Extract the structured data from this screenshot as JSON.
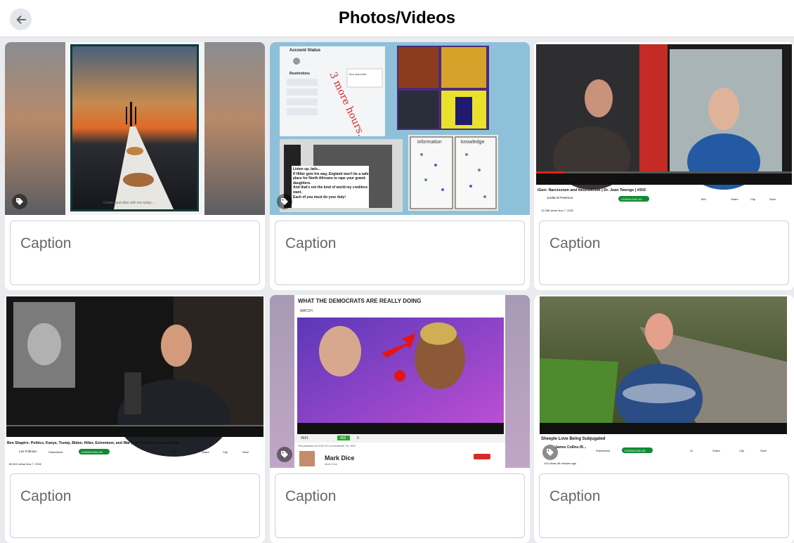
{
  "header": {
    "title": "Photos/Videos",
    "back_icon": "arrow-left-icon"
  },
  "caption_placeholder": "Caption",
  "cards": [
    {
      "texts": [
        "Comes and dine with me today…"
      ]
    },
    {
      "texts": [
        "Account Status",
        "Restrictions",
        "3 more hours.",
        "Your accounts",
        "information",
        "knowledge",
        "Listen up, lads...",
        "If Hitler gets his way, England won't be a safe place for North Africans to rape your grand-daughters.",
        "And that's not the kind of world my creditors want.",
        "Each of you must do your duty!"
      ]
    },
    {
      "texts": [
        "iGen: Narcissism and Neuroticism | Dr. Jean Twenge | #303",
        "Jordan B Peterson",
        "DOWNLOAD AS",
        "893",
        "Share",
        "Clip",
        "Save",
        "12,258 views  Nov 7, 2022"
      ]
    },
    {
      "texts": [
        "Ben Shapiro: Politics, Kanye, Trump, Biden, Hitler, Extremism, and War | Lex Fridman Podcast #336",
        "Lex Fridman",
        "Subscribed",
        "DOWNLOAD AS",
        "4.9K",
        "Share",
        "Clip",
        "Save",
        "80,513 views  Nov 7, 2022"
      ]
    },
    {
      "texts": [
        "WHAT THE DEMOCRATS ARE REALLY DOING",
        "WATCH",
        "4691",
        "403",
        "0",
        "First published at 13:30 UTC on November 7th, 2022",
        "Mark Dice",
        "Mark Dice"
      ]
    },
    {
      "texts": [
        "Sheeple Love Being Subjugated",
        "James Collins IR...",
        "Subscribed",
        "DOWNLOAD AS",
        "41",
        "Share",
        "Clip",
        "Save",
        "143 views  48 minutes ago"
      ]
    }
  ]
}
